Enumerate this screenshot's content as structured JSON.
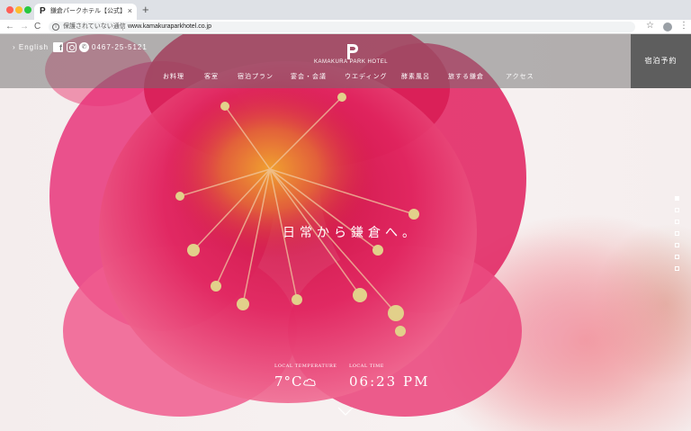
{
  "browser": {
    "tab_favicon": "P",
    "tab_title": "鎌倉パークホテル【公式】| KAMAKURA PARK HOTEL",
    "tab_close": "×",
    "new_tab": "+",
    "back": "←",
    "forward": "→",
    "reload": "C",
    "security_text": "保護されていない通信",
    "url": "www.kamakuraparkhotel.co.jp",
    "bookmark": "☆",
    "menu": "⋮"
  },
  "header": {
    "lang_link": "› English",
    "facebook": "f",
    "phone_glyph": "✆",
    "phone": "0467-25-5121",
    "logo_text": "KAMAKURA  PARK HOTEL",
    "nav": [
      {
        "label": "お料理"
      },
      {
        "label": "客室"
      },
      {
        "label": "宿泊プラン"
      },
      {
        "label": "宴会・会議"
      },
      {
        "label": "ウエディング"
      },
      {
        "label": "酵素風呂"
      },
      {
        "label": "旅する鎌倉"
      },
      {
        "label": "アクセス"
      }
    ],
    "reserve_label": "宿泊予約"
  },
  "hero": {
    "catchcopy": "日常から鎌倉へ。",
    "weather_label": "LOCAL TEMPERATURE",
    "temperature": "7°C",
    "time_label": "LOCAL TIME",
    "time": "06:23 PM",
    "slides": 7,
    "active_slide": 1
  },
  "colors": {
    "header_overlay": "#6e6e6e",
    "reserve_bg": "#5e5e5e",
    "petal": "#e0245e",
    "stamen": "#e2d08a"
  }
}
